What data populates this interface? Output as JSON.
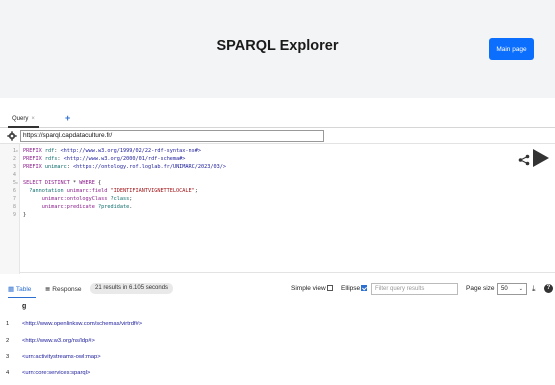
{
  "header": {
    "title": "SPARQL Explorer",
    "main_page_button": "Main page"
  },
  "tabs": {
    "query_tab_label": "Query",
    "query_tab_close": "×",
    "add_tab": "+"
  },
  "endpoint": {
    "url": "https://sparql.capdataculture.fr/"
  },
  "editor": {
    "lines": [
      {
        "num": "1",
        "fold": "▸",
        "parts": [
          [
            "kw",
            "PREFIX "
          ],
          [
            "var",
            "rdf"
          ],
          [
            "plain",
            ": "
          ],
          [
            "uri",
            "<http://www.w3.org/1999/02/22-rdf-syntax-ns#>"
          ]
        ]
      },
      {
        "num": "2",
        "fold": "",
        "parts": [
          [
            "kw",
            "PREFIX "
          ],
          [
            "var",
            "rdfs"
          ],
          [
            "plain",
            ": "
          ],
          [
            "uri",
            "<http://www.w3.org/2000/01/rdf-schema#>"
          ]
        ]
      },
      {
        "num": "3",
        "fold": "",
        "parts": [
          [
            "kw",
            "PREFIX "
          ],
          [
            "var",
            "unimarc"
          ],
          [
            "plain",
            ": "
          ],
          [
            "uri",
            "<https://ontology.rof.loglab.fr/UNIMARC/2023/03/>"
          ]
        ]
      },
      {
        "num": "4",
        "fold": "",
        "parts": []
      },
      {
        "num": "5",
        "fold": "▸",
        "parts": [
          [
            "kw",
            "SELECT DISTINCT "
          ],
          [
            "plain",
            "* "
          ],
          [
            "kw",
            "WHERE "
          ],
          [
            "plain",
            "{"
          ]
        ]
      },
      {
        "num": "6",
        "fold": "",
        "parts": [
          [
            "plain",
            "  "
          ],
          [
            "var",
            "?annotation "
          ],
          [
            "kw",
            "unimarc:field "
          ],
          [
            "str",
            "\"IDENTIFIANTVIGNETTELOCALE\""
          ],
          [
            "plain",
            ";"
          ]
        ]
      },
      {
        "num": "7",
        "fold": "",
        "parts": [
          [
            "plain",
            "      "
          ],
          [
            "kw",
            "unimarc:ontologyClass "
          ],
          [
            "var",
            "?class"
          ],
          [
            "plain",
            ";"
          ]
        ]
      },
      {
        "num": "8",
        "fold": "",
        "parts": [
          [
            "plain",
            "      "
          ],
          [
            "kw",
            "unimarc:predicate "
          ],
          [
            "var",
            "?predidate"
          ],
          [
            "plain",
            "."
          ]
        ]
      },
      {
        "num": "9",
        "fold": "",
        "parts": [
          [
            "plain",
            "}"
          ]
        ]
      }
    ]
  },
  "results_toolbar": {
    "table_label": "Table",
    "response_label": "Response",
    "count_text": "21 results in 6.105 seconds",
    "simple_view_label": "Simple view",
    "ellipse_label": "Ellipse",
    "filter_placeholder": "Filter query results",
    "page_size_label": "Page size",
    "page_size_value": "50",
    "help_label": "?"
  },
  "results": {
    "column": "g",
    "rows": [
      {
        "index": "1",
        "value": "<http://www.openlinksw.com/schemas/virtrdf#>"
      },
      {
        "index": "2",
        "value": "<http://www.w3.org/ns/ldp#>"
      },
      {
        "index": "3",
        "value": "<urn:activitystreams-owl:map>"
      },
      {
        "index": "4",
        "value": "<urn:core:services:sparql>"
      }
    ]
  },
  "colors": {
    "primary": "#0b6efd",
    "header_bg": "#f3f4f5",
    "link": "#2c6fd1"
  }
}
